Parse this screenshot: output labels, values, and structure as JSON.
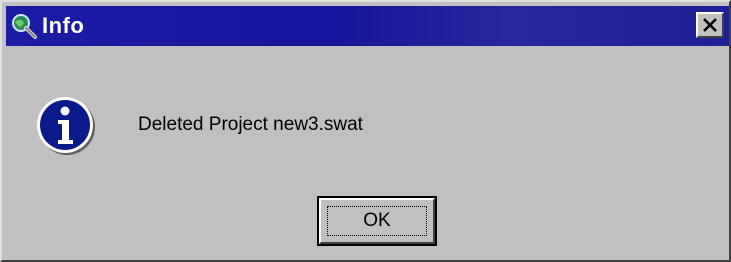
{
  "window": {
    "title": "Info",
    "title_icon": "magnifier-globe-icon",
    "close_icon": "close-icon"
  },
  "dialog": {
    "icon": "info-icon",
    "message": "Deleted Project new3.swat",
    "ok_label": "OK"
  },
  "colors": {
    "titlebar": "#1b1ba6",
    "face": "#c0c0c0",
    "info_blue": "#0a1a8c"
  }
}
